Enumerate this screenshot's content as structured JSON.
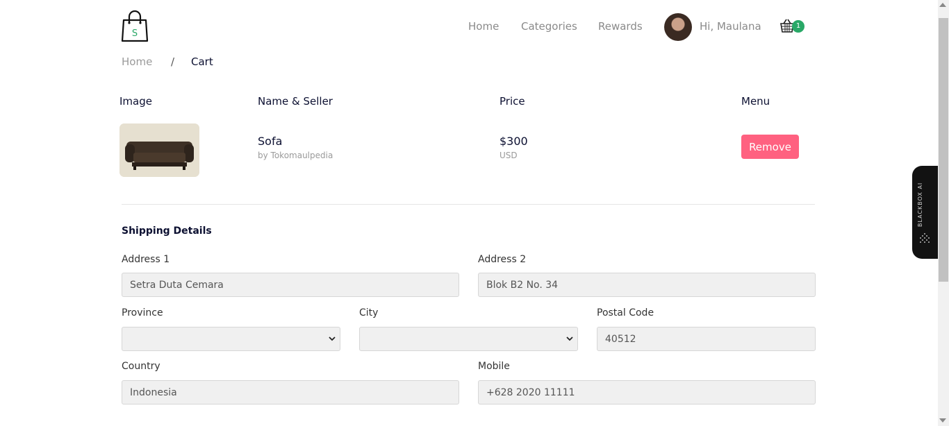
{
  "header": {
    "logo_icon": "shopping-bag-dollar-icon",
    "nav": [
      "Home",
      "Categories",
      "Rewards"
    ],
    "greeting": "Hi, Maulana",
    "cart_icon": "shopping-basket-icon",
    "cart_count": "1",
    "accent_color": "#29a867"
  },
  "breadcrumb": {
    "home": "Home",
    "separator": "/",
    "current": "Cart"
  },
  "table": {
    "headers": [
      "Image",
      "Name & Seller",
      "Price",
      "Menu"
    ],
    "rows": [
      {
        "name": "Sofa",
        "seller": "by Tokomaulpedia",
        "price": "$300",
        "currency": "USD",
        "action": "Remove"
      }
    ],
    "remove_color": "#ff6180"
  },
  "shipping": {
    "title": "Shipping Details",
    "address1": {
      "label": "Address 1",
      "value": "Setra Duta Cemara"
    },
    "address2": {
      "label": "Address 2",
      "value": "Blok B2 No. 34"
    },
    "province": {
      "label": "Province",
      "value": ""
    },
    "city": {
      "label": "City",
      "value": ""
    },
    "postal": {
      "label": "Postal Code",
      "value": "40512"
    },
    "country": {
      "label": "Country",
      "value": "Indonesia"
    },
    "mobile": {
      "label": "Mobile",
      "value": "+628 2020 11111"
    }
  },
  "side_widget": {
    "label": "BLACKBOX AI"
  }
}
